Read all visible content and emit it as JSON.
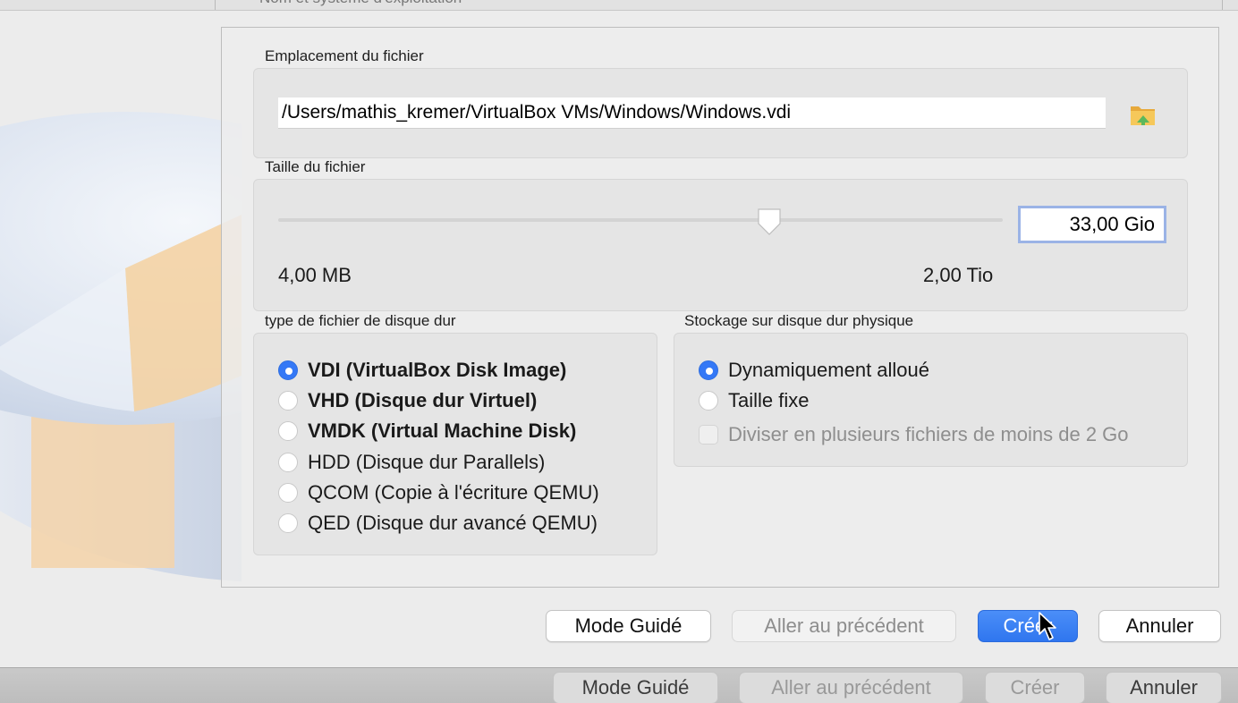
{
  "background": {
    "cut_text": "Nom et système d'exploitation"
  },
  "file_location": {
    "label": "Emplacement du fichier",
    "path_value": "/Users/mathis_kremer/VirtualBox VMs/Windows/Windows.vdi",
    "folder_icon": "folder-icon"
  },
  "file_size": {
    "label": "Taille du fichier",
    "value": "33,00 Gio",
    "min_label": "4,00 MB",
    "max_label": "2,00 Tio"
  },
  "disk_type": {
    "label": "type de fichier de disque dur",
    "options": [
      {
        "label": "VDI (VirtualBox Disk Image)",
        "selected": true,
        "bold": true
      },
      {
        "label": "VHD (Disque dur Virtuel)",
        "selected": false,
        "bold": true
      },
      {
        "label": "VMDK (Virtual Machine Disk)",
        "selected": false,
        "bold": true
      },
      {
        "label": "HDD (Disque dur Parallels)",
        "selected": false,
        "bold": false
      },
      {
        "label": "QCOM (Copie à l'écriture QEMU)",
        "selected": false,
        "bold": false
      },
      {
        "label": "QED (Disque dur avancé QEMU)",
        "selected": false,
        "bold": false
      }
    ]
  },
  "storage": {
    "label": "Stockage sur disque dur physique",
    "options": [
      {
        "label": "Dynamiquement alloué",
        "selected": true
      },
      {
        "label": "Taille fixe",
        "selected": false
      }
    ],
    "split_checkbox_label": "Diviser en plusieurs fichiers de moins de 2 Go"
  },
  "buttons": {
    "guided": "Mode Guidé",
    "previous": "Aller au précédent",
    "create": "Créer",
    "cancel": "Annuler"
  },
  "background_buttons": {
    "guided": "Mode Guidé",
    "previous": "Aller au précédent",
    "create": "Créer",
    "cancel": "Annuler"
  },
  "colors": {
    "accent": "#3478f6",
    "size_field_focus": "#9bb3e6"
  }
}
